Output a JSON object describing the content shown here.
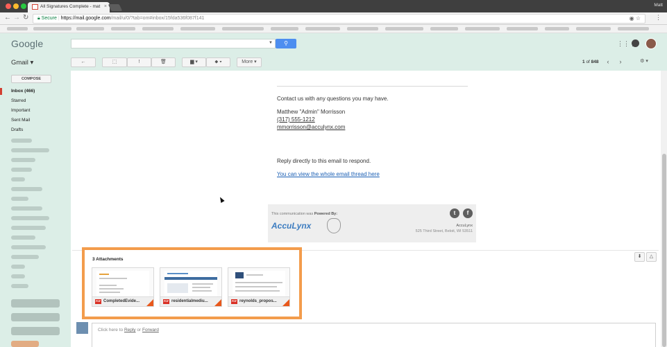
{
  "browser": {
    "tab_title": "All Signatures Complete - mat",
    "tab_close": "×",
    "profile_name": "Matt",
    "secure_label": "Secure",
    "url_main": "https://mail.google.com",
    "url_path": "/mail/u/0/?tab=om#inbox/15fda536f087f141",
    "back_icon": "←",
    "forward_icon": "→",
    "reload_icon": "↻"
  },
  "gmail": {
    "logo": "Google",
    "app_label": "Gmail ▾",
    "search_btn_icon": "🔍",
    "toolbar": {
      "back": "←",
      "archive": "⬚",
      "spam": "!",
      "delete": "🗑",
      "move": "▆ ▾",
      "labels": "⬥ ▾",
      "more": "More ▾"
    },
    "pager": {
      "range": "1",
      "total": "848",
      "of": "of"
    },
    "settings": "⚙ ▾"
  },
  "sidebar": {
    "compose": "COMPOSE",
    "items": [
      {
        "label": "Inbox (466)",
        "active": true
      },
      {
        "label": "Starred"
      },
      {
        "label": "Important"
      },
      {
        "label": "Sent Mail"
      },
      {
        "label": "Drafts"
      }
    ]
  },
  "message": {
    "contact_line": "Contact us with any questions you may have.",
    "sender_name": "Matthew \"Admin\" Morrisson",
    "phone": "(317) 555-1212",
    "email": "mmorrisson@acculynx.com",
    "reply_directly": "Reply directly to this email to respond.",
    "thread_link": "You can view the whole email thread here",
    "footer": {
      "powered_prefix": "This communication was ",
      "powered_bold": "Powered By:",
      "brand": "AccuLynx",
      "company": "AccuLynx",
      "address": "525 Third Street, Beloit, WI 53511",
      "twitter": "t",
      "facebook": "f"
    }
  },
  "attachments": {
    "title": "3 Attachments",
    "items": [
      {
        "name": "CompletedEvide...",
        "type": "PDF"
      },
      {
        "name": "residentialmediu...",
        "type": "PDF"
      },
      {
        "name": "reynolds_propos...",
        "type": "PDF"
      }
    ],
    "download_icon": "⬇",
    "drive_icon": "△"
  },
  "reply": {
    "prefix": "Click here to ",
    "reply_link": "Reply",
    "or": " or ",
    "forward_link": "Forward"
  }
}
